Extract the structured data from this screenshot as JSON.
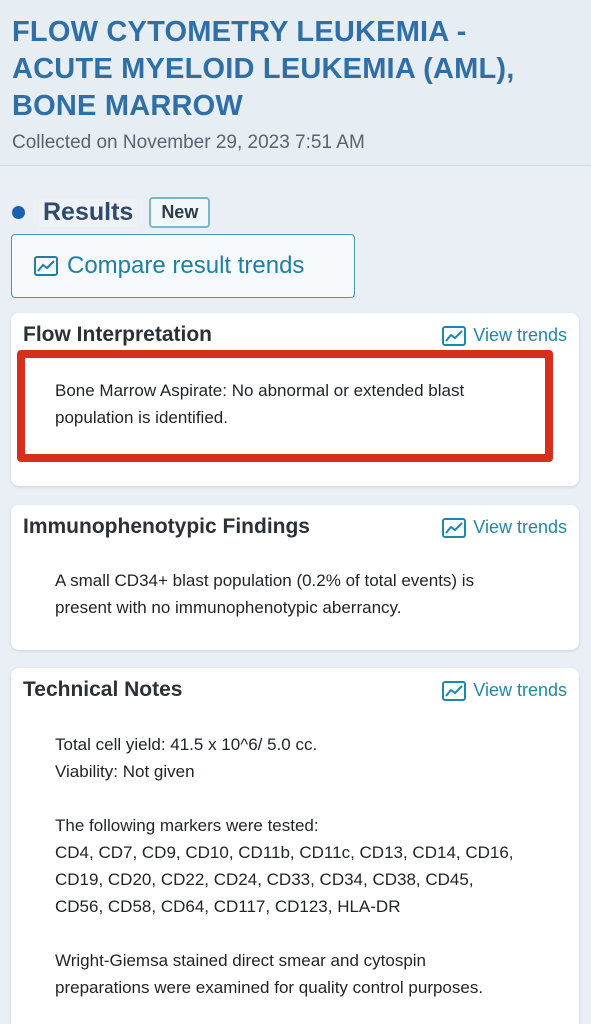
{
  "header": {
    "title": "FLOW CYTOMETRY LEUKEMIA - ACUTE MYELOID LEUKEMIA (AML), BONE MARROW",
    "collected": "Collected on November 29, 2023 7:51 AM"
  },
  "results": {
    "label": "Results",
    "badge": "New",
    "compare_button": "Compare result trends"
  },
  "cards": [
    {
      "title": "Flow Interpretation",
      "view_trends": "View trends",
      "lines": [
        "Bone Marrow Aspirate: No abnormal or extended blast",
        "population is identified."
      ]
    },
    {
      "title": "Immunophenotypic Findings",
      "view_trends": "View trends",
      "lines": [
        "A small CD34+ blast population (0.2% of total events) is",
        "present with no immunophenotypic aberrancy."
      ]
    },
    {
      "title": "Technical Notes",
      "view_trends": "View trends",
      "lines": [
        "Total cell yield: 41.5 x 10^6/ 5.0 cc.",
        "Viability: Not given",
        "",
        "The following markers were tested:",
        "CD4, CD7, CD9, CD10, CD11b, CD11c, CD13, CD14, CD16,",
        "CD19, CD20, CD22, CD24, CD33, CD34, CD38, CD45,",
        "CD56, CD58, CD64, CD117, CD123, HLA-DR",
        "",
        "Wright-Giemsa stained direct smear and cytospin",
        "preparations were examined for quality control purposes."
      ]
    }
  ],
  "colors": {
    "title": "#2f6fa6",
    "accent": "#1e88a8",
    "highlight": "#d72f1c",
    "dot": "#1c5fb0"
  },
  "icons": {
    "trend": "trend-chart-icon"
  }
}
